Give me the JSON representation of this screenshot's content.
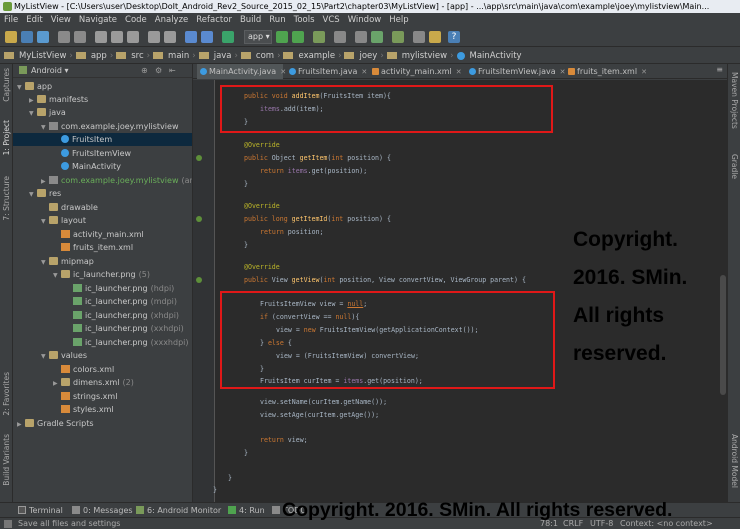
{
  "window": {
    "title": "MyListView - [C:\\Users\\user\\Desktop\\DoIt_Android_Rev2_Source_2015_02_15\\Part2\\chapter03\\MyListView] - [app] - ...\\app\\src\\main\\java\\com\\example\\joey\\mylistview\\Main..."
  },
  "menu": [
    "File",
    "Edit",
    "View",
    "Navigate",
    "Code",
    "Analyze",
    "Refactor",
    "Build",
    "Run",
    "Tools",
    "VCS",
    "Window",
    "Help"
  ],
  "toolbar": {
    "config": "app"
  },
  "breadcrumb": [
    "MyListView",
    "app",
    "src",
    "main",
    "java",
    "com",
    "example",
    "joey",
    "mylistview",
    "MainActivity"
  ],
  "left_strip": [
    "Captures",
    "1: Project",
    "7: Structure",
    "2: Favorites",
    "Build Variants"
  ],
  "right_strip": [
    "Maven Projects",
    "Gradle",
    "Android Model"
  ],
  "project": {
    "view": "Android",
    "tree": [
      {
        "label": "app",
        "kind": "folder"
      },
      {
        "label": "manifests",
        "kind": "folder"
      },
      {
        "label": "java",
        "kind": "folder"
      },
      {
        "label": "com.example.joey.mylistview",
        "kind": "pkg"
      },
      {
        "label": "FruitsItem",
        "kind": "cls"
      },
      {
        "label": "FruitsItemView",
        "kind": "cls"
      },
      {
        "label": "MainActivity",
        "kind": "cls"
      },
      {
        "label": "com.example.joey.mylistview",
        "suffix": "(andro",
        "kind": "pkg"
      },
      {
        "label": "res",
        "kind": "folder"
      },
      {
        "label": "drawable",
        "kind": "folder"
      },
      {
        "label": "layout",
        "kind": "folder"
      },
      {
        "label": "activity_main.xml",
        "kind": "xml"
      },
      {
        "label": "fruits_item.xml",
        "kind": "xml"
      },
      {
        "label": "mipmap",
        "kind": "folder"
      },
      {
        "label": "ic_launcher.png",
        "suffix": "(5)",
        "kind": "folder"
      },
      {
        "label": "ic_launcher.png",
        "suffix": "(hdpi)",
        "kind": "img"
      },
      {
        "label": "ic_launcher.png",
        "suffix": "(mdpi)",
        "kind": "img"
      },
      {
        "label": "ic_launcher.png",
        "suffix": "(xhdpi)",
        "kind": "img"
      },
      {
        "label": "ic_launcher.png",
        "suffix": "(xxhdpi)",
        "kind": "img"
      },
      {
        "label": "ic_launcher.png",
        "suffix": "(xxxhdpi)",
        "kind": "img"
      },
      {
        "label": "values",
        "kind": "folder"
      },
      {
        "label": "colors.xml",
        "kind": "xml"
      },
      {
        "label": "dimens.xml",
        "suffix": "(2)",
        "kind": "folder"
      },
      {
        "label": "strings.xml",
        "kind": "xml"
      },
      {
        "label": "styles.xml",
        "kind": "xml"
      },
      {
        "label": "Gradle Scripts",
        "kind": "folder"
      }
    ]
  },
  "tabs": [
    "MainActivity.java",
    "FruitsItem.java",
    "activity_main.xml",
    "FruitsItemView.java",
    "fruits_item.xml"
  ],
  "code": [
    "public void addItem(FruitsItem item){",
    "items.add(item);",
    "}",
    "@Override",
    "public Object getItem(int position) {",
    "return items.get(position);",
    "}",
    "@Override",
    "public long getItemId(int position) {",
    "return position;",
    "}",
    "@Override",
    "public View getView(int position, View convertView, ViewGroup parent) {",
    "FruitsItemView view = null;",
    "if (convertView == null){",
    "view = new FruitsItemView(getApplicationContext());",
    "} else {",
    "view = (FruitsItemView) convertView;",
    "}",
    "FruitsItem curItem = items.get(position);",
    "view.setName(curItem.getName());",
    "view.setAge(curItem.getAge());",
    "return view;",
    "}",
    "}"
  ],
  "watermark": {
    "side": [
      "Copyright.",
      "2016. SMin.",
      "All rights",
      "reserved."
    ],
    "bottom": "Copyright. 2016. SMin. All rights reserved."
  },
  "bottom_tabs": [
    "Terminal",
    "0: Messages",
    "6: Android Monitor",
    "4: Run",
    "TODO"
  ],
  "status": {
    "message": "Save all files and settings",
    "position": "78:1",
    "line_sep": "CRLF",
    "encoding": "UTF-8",
    "context": "Context: <no context>"
  },
  "colors": {
    "editor_bg": "#2b2b2b",
    "keyword": "#cc7832",
    "method": "#ffc66d",
    "annotation": "#bbb529",
    "field": "#9876aa",
    "highlight_box": "#e01818"
  }
}
